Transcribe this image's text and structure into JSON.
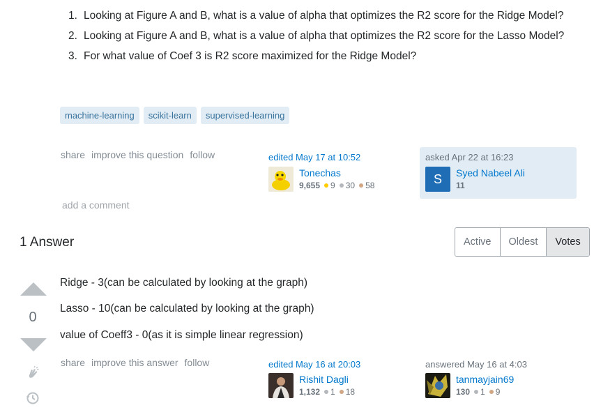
{
  "question": {
    "items": [
      {
        "num": "1.",
        "text": "Looking at Figure A and B, what is a value of alpha that optimizes the R2 score for the Ridge Model?"
      },
      {
        "num": "2.",
        "text": "Looking at Figure A and B, what is a value of alpha that optimizes the R2 score for the Lasso Model?"
      },
      {
        "num": "3.",
        "text": "For what value of Coef 3 is R2 score maximized for the Ridge Model?"
      }
    ],
    "tags": [
      "machine-learning",
      "scikit-learn",
      "supervised-learning"
    ],
    "menu": {
      "share": "share",
      "improve": "improve this question",
      "follow": "follow"
    },
    "edited": {
      "action": "edited May 17 at 10:52",
      "user": "Tonechas",
      "rep": "9,655",
      "gold": "9",
      "silver": "30",
      "bronze": "58"
    },
    "asked": {
      "action": "asked Apr 22 at 16:23",
      "user": "Syed Nabeel Ali",
      "avatar_letter": "S",
      "rep": "11"
    },
    "add_comment": "add a comment"
  },
  "answers_header": {
    "title": "1 Answer",
    "sort_tabs": [
      "Active",
      "Oldest",
      "Votes"
    ],
    "active_tab": "Votes"
  },
  "answer": {
    "vote_count": "0",
    "lines": [
      "Ridge - 3(can be calculated by looking at the graph)",
      "Lasso - 10(can be calculated by looking at the graph)",
      "value of Coeff3 - 0(as it is simple linear regression)"
    ],
    "menu": {
      "share": "share",
      "improve": "improve this answer",
      "follow": "follow"
    },
    "edited": {
      "action": "edited May 16 at 20:03",
      "user": "Rishit Dagli",
      "rep": "1,132",
      "silver": "1",
      "bronze": "18"
    },
    "answered": {
      "action": "answered May 16 at 4:03",
      "user": "tanmayjain69",
      "rep": "130",
      "silver": "1",
      "bronze": "9"
    }
  },
  "colors": {
    "gold": "#ffcc01",
    "silver": "#b4b8bc",
    "bronze": "#d1a684",
    "link": "#0077cc",
    "owner_bg": "#e1ecf4"
  }
}
